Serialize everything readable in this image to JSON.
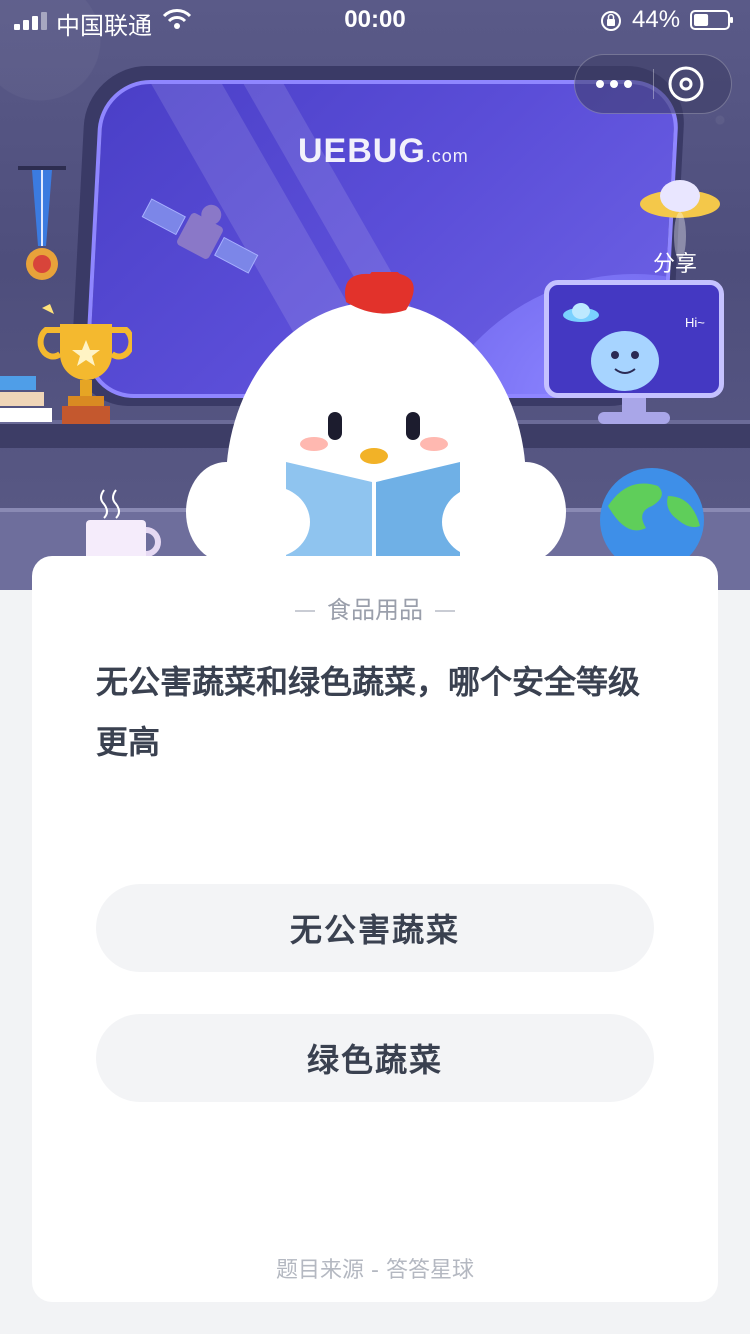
{
  "status_bar": {
    "carrier": "中国联通",
    "time": "00:00",
    "battery": "44%",
    "battery_level": 0.44
  },
  "capsule": {
    "more_icon": "more-dots-icon",
    "close_icon": "close-circle-icon"
  },
  "hero": {
    "logo_text": "UEBUG",
    "logo_suffix": ".com",
    "monitor_greeting": "Hi~",
    "share_label": "分享"
  },
  "quiz": {
    "category": "食品用品",
    "question": "无公害蔬菜和绿色蔬菜，哪个安全等级更高",
    "options": [
      {
        "label": "无公害蔬菜"
      },
      {
        "label": "绿色蔬菜"
      }
    ],
    "source": "题目来源 - 答答星球"
  },
  "colors": {
    "scene_bg": "#53537f",
    "window_glass": "#5b4ed8",
    "card_bg": "#ffffff",
    "option_bg": "#f3f4f6",
    "text_primary": "#3a4150",
    "text_muted": "#9a9fab"
  }
}
